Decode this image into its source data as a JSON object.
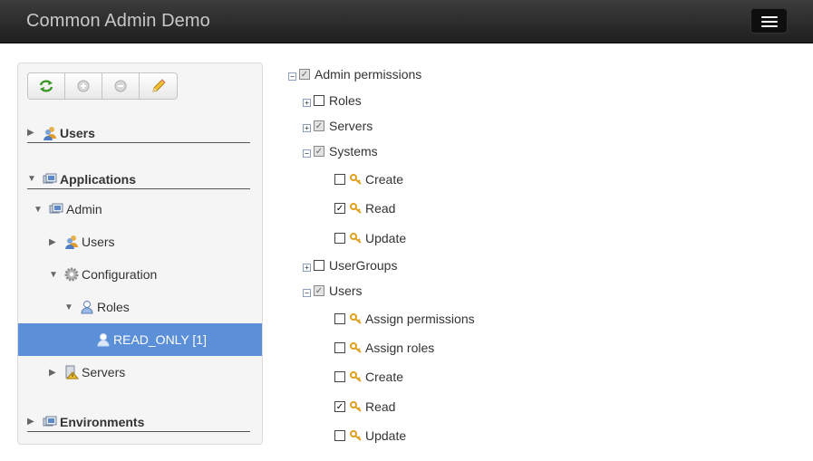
{
  "header": {
    "title": "Common Admin Demo"
  },
  "left": {
    "toolbar": {
      "refresh_icon": "refresh-icon",
      "add_icon": "add-circle-icon",
      "remove_icon": "remove-circle-icon",
      "edit_icon": "pencil-icon"
    },
    "sections": {
      "users": "Users",
      "applications": "Applications",
      "environments": "Environments"
    },
    "tree": {
      "admin": "Admin",
      "users": "Users",
      "configuration": "Configuration",
      "roles": "Roles",
      "read_only": "READ_ONLY [1]",
      "servers": "Servers"
    }
  },
  "right": {
    "root": "Admin permissions",
    "nodes": {
      "roles": "Roles",
      "servers": "Servers",
      "systems": "Systems",
      "systems_create": "Create",
      "systems_read": "Read",
      "systems_update": "Update",
      "usergroups": "UserGroups",
      "users": "Users",
      "users_assign_permissions": "Assign permissions",
      "users_assign_roles": "Assign roles",
      "users_create": "Create",
      "users_read": "Read",
      "users_update": "Update"
    }
  },
  "colors": {
    "navbar": "#222222",
    "selection": "#5b8fd8",
    "key_icon": "#e0a020"
  }
}
